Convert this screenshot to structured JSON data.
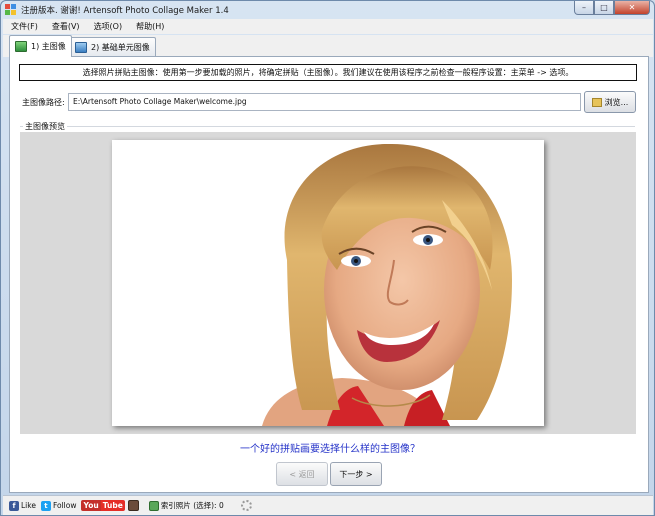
{
  "window": {
    "title": "注册版本. 谢谢! Artensoft Photo Collage Maker 1.4",
    "controls": {
      "minimize": "–",
      "maximize": "□",
      "close": "✕"
    }
  },
  "menu": [
    "文件(F)",
    "查看(V)",
    "选项(O)",
    "帮助(H)"
  ],
  "tabs": [
    {
      "label": "1) 主图像",
      "active": true
    },
    {
      "label": "2) 基础单元图像",
      "active": false
    }
  ],
  "instructions": "选择照片拼贴主图像：使用第一步要加载的照片，将确定拼贴（主图像）。我们建议在使用该程序之前检查一般程序设置：主菜单 -> 选项。",
  "path": {
    "label": "主图像路径:",
    "value": "E:\\Artensoft Photo Collage Maker\\welcome.jpg",
    "browse_label": "浏览..."
  },
  "preview": {
    "group_label": "主图像预览"
  },
  "question": "一个好的拼贴画要选择什么样的主图像？",
  "nav": {
    "back_label": "< 返回",
    "next_label": "下一步 >"
  },
  "statusbar": {
    "facebook_label": "Like",
    "twitter_label": "Follow",
    "youtube_you": "You",
    "youtube_tube": "Tube",
    "index_label": "索引照片 (选择): 0"
  },
  "colors": {
    "accent_text": "#2432c8",
    "window_frame": "#c3d5ea",
    "close_button": "#c2432c"
  }
}
